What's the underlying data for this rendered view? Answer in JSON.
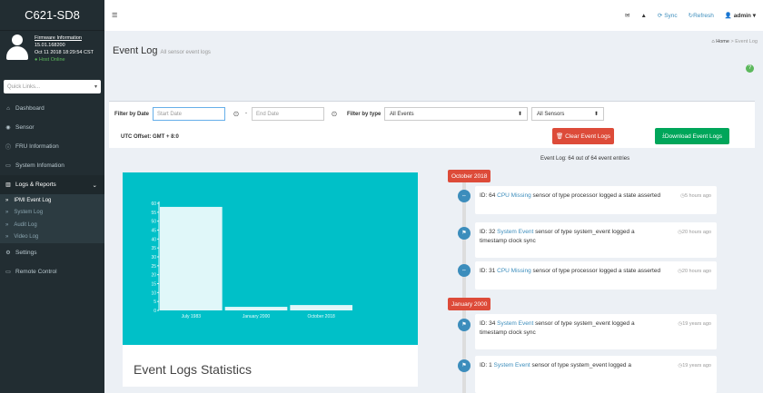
{
  "sidebar": {
    "brand": "C621-SD8",
    "user": {
      "firmware_link": "Firmware Information",
      "firmware_version": "15.01.168200",
      "datetime": "Oct 11 2018 18:29:54 CST",
      "status": "Host Online"
    },
    "quick_links": "Quick Links...",
    "items": [
      {
        "label": "Dashboard",
        "icon": "dashboard-icon"
      },
      {
        "label": "Sensor",
        "icon": "sensor-icon"
      },
      {
        "label": "FRU Information",
        "icon": "info-icon"
      },
      {
        "label": "System Infomation",
        "icon": "monitor-icon"
      },
      {
        "label": "Logs & Reports",
        "icon": "chart-icon"
      },
      {
        "label": "Settings",
        "icon": "gear-icon"
      },
      {
        "label": "Remote Control",
        "icon": "desktop-icon"
      }
    ],
    "subitems": [
      "IPMI Event Log",
      "System Log",
      "Audit Log",
      "Video Log"
    ]
  },
  "topbar": {
    "sync": "Sync",
    "refresh": "Refresh",
    "user": "admin"
  },
  "header": {
    "title": "Event Log",
    "subtitle": "All sensor event logs",
    "crumb_home": "Home",
    "crumb_current": "Event Log"
  },
  "filters": {
    "by_date_label": "Filter by Date",
    "start_placeholder": "Start Date",
    "end_placeholder": "End Date",
    "dash": "-",
    "by_type_label": "Filter by type",
    "type_value": "All Events",
    "sensor_value": "All Sensors",
    "utc": "UTC Offset: GMT + 8:0",
    "clear_btn": "Clear Event Logs",
    "download_btn": "Download Event Logs"
  },
  "stats": {
    "title": "Event Logs Statistics"
  },
  "chart_data": {
    "type": "bar",
    "categories": [
      "July 1983",
      "January 2000",
      "October 2018"
    ],
    "values": [
      58,
      2,
      3
    ],
    "ylim": [
      0,
      60
    ],
    "yticks": [
      0,
      5,
      10,
      15,
      20,
      25,
      30,
      35,
      40,
      45,
      50,
      55,
      60
    ],
    "bar_color": "#e0f7f9",
    "bg_color": "#00c0c8"
  },
  "timeline": {
    "count_text": "Event Log: 64 out of 64 event entries",
    "groups": [
      {
        "date": "October 2018"
      },
      {
        "date": "January 2000"
      }
    ],
    "entries": [
      {
        "id": "ID: 64",
        "link": "CPU Missing",
        "text": "sensor of type processor logged a state asserted",
        "time": "5 hours ago"
      },
      {
        "id": "ID: 32",
        "link": "System Event",
        "text": "sensor of type system_event logged a timestamp clock sync",
        "time": "20 hours ago"
      },
      {
        "id": "ID: 31",
        "link": "CPU Missing",
        "text": "sensor of type processor logged a state asserted",
        "time": "20 hours ago"
      },
      {
        "id": "ID: 34",
        "link": "System Event",
        "text": "sensor of type system_event logged a timestamp clock sync",
        "time": "19 years ago"
      },
      {
        "id": "ID: 1",
        "link": "System Event",
        "text": "sensor of type system_event logged a",
        "time": "19 years ago"
      }
    ]
  },
  "colors": {
    "accent": "#3c8dbc",
    "danger": "#dd4b39",
    "success": "#00a65a",
    "sidebar": "#222d32"
  }
}
